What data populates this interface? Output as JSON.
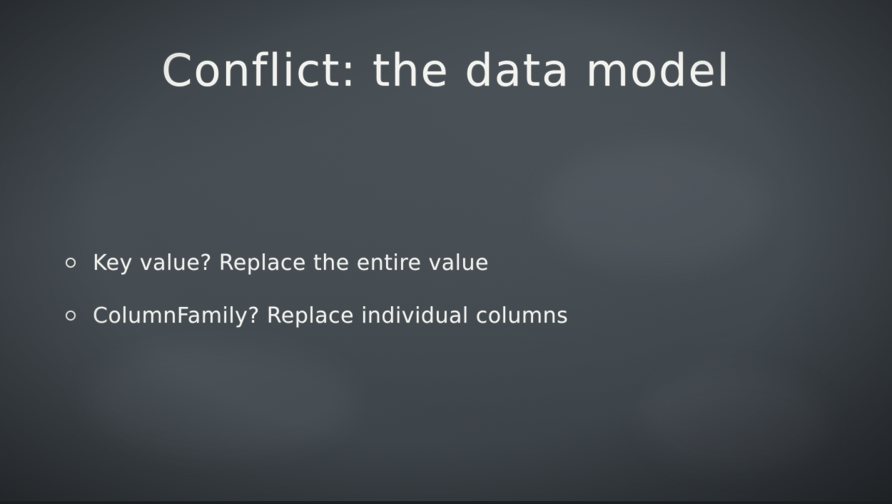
{
  "slide": {
    "title": "Conflict: the data model",
    "bullets": [
      "Key value? Replace the entire value",
      "ColumnFamily? Replace individual columns"
    ],
    "colors": {
      "background": "#3d4449",
      "chalk": "#f2f2ee"
    }
  }
}
